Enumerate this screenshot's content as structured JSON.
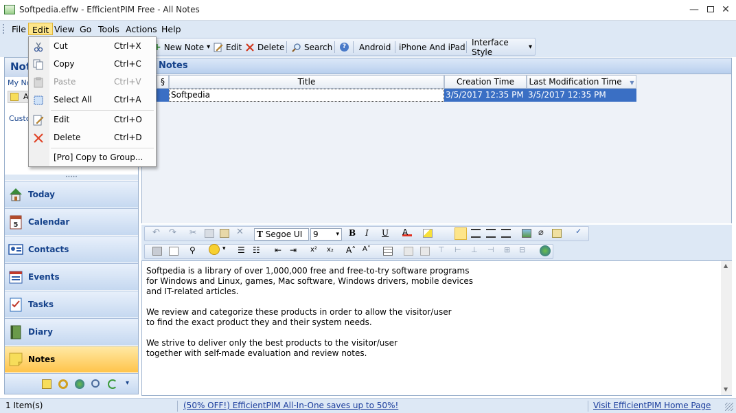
{
  "window": {
    "title": "Softpedia.effw - EfficientPIM Free - All Notes",
    "minimize": "—",
    "close": "✕"
  },
  "menubar": {
    "items": [
      "File",
      "Edit",
      "View",
      "Go",
      "Tools",
      "Actions",
      "Help"
    ]
  },
  "toolbar": {
    "new_note": "New Note",
    "edit": "Edit",
    "delete": "Delete",
    "search": "Search",
    "android": "Android",
    "iphone": "iPhone And iPad",
    "interface_style": "Interface Style",
    "dropdown_arrow": "▾"
  },
  "edit_menu": {
    "items": [
      {
        "label": "Cut",
        "shortcut": "Ctrl+X",
        "icon": "scissors-icon",
        "enabled": true
      },
      {
        "label": "Copy",
        "shortcut": "Ctrl+C",
        "icon": "copy-icon",
        "enabled": true
      },
      {
        "label": "Paste",
        "shortcut": "Ctrl+V",
        "icon": "paste-icon",
        "enabled": false
      },
      {
        "label": "Select All",
        "shortcut": "Ctrl+A",
        "icon": "select-all-icon",
        "enabled": true
      },
      {
        "label": "Edit",
        "shortcut": "Ctrl+O",
        "icon": "edit-pencil-icon",
        "enabled": true
      },
      {
        "label": "Delete",
        "shortcut": "Ctrl+D",
        "icon": "delete-x-icon",
        "enabled": true
      },
      {
        "label": "[Pro] Copy to Group...",
        "shortcut": "",
        "icon": "",
        "enabled": true
      }
    ]
  },
  "left_pane": {
    "header": "Not",
    "tree_item": "My No",
    "tree_sub": "A",
    "custom_label": "Custo",
    "splitter": "•••••",
    "nav": [
      {
        "label": "Today",
        "icon": "house-icon",
        "color": "#3a8a3a"
      },
      {
        "label": "Calendar",
        "icon": "calendar-icon",
        "color": "#b04a2a"
      },
      {
        "label": "Contacts",
        "icon": "contacts-card-icon",
        "color": "#2a5aa8"
      },
      {
        "label": "Events",
        "icon": "events-icon",
        "color": "#c0392b"
      },
      {
        "label": "Tasks",
        "icon": "tasks-checklist-icon",
        "color": "#2a6ab8"
      },
      {
        "label": "Diary",
        "icon": "diary-book-icon",
        "color": "#4a7a3a"
      },
      {
        "label": "Notes",
        "icon": "sticky-note-icon",
        "color": "#f5d34a"
      }
    ]
  },
  "main": {
    "header": "Notes",
    "columns": {
      "attach_glyph": "§",
      "title": "Title",
      "created": "Creation Time",
      "modified": "Last Modification Time",
      "sort_glyph": "▼"
    },
    "rows": [
      {
        "title": "Softpedia",
        "created": "3/5/2017 12:35 PM",
        "modified": "3/5/2017 12:35 PM"
      }
    ]
  },
  "editor_toolbar": {
    "font_prefix": "T",
    "font_name": "Segoe UI",
    "font_size": "9",
    "dropdown_arrow": "▾",
    "format": {
      "bold": "B",
      "italic": "I",
      "underline": "U",
      "font_color": "A",
      "superscript": "x²",
      "subscript": "x₂",
      "grow_font": "A˄",
      "shrink_font": "A˅"
    }
  },
  "editor": {
    "text": "Softpedia is a library of over 1,000,000 free and free-to-try software programs\nfor Windows and Linux, games, Mac software, Windows drivers, mobile devices\nand IT-related articles.\n\nWe review and categorize these products in order to allow the visitor/user\nto find the exact product they and their system needs.\n\nWe strive to deliver only the best products to the visitor/user\ntogether with self-made evaluation and review notes."
  },
  "statusbar": {
    "count": "1 Item(s)",
    "promo": "(50% OFF!) EfficientPIM All-In-One saves up to 50%!",
    "home": "Visit EfficientPIM Home Page"
  },
  "colors": {
    "accent": "#15428b",
    "selection": "#3a6fc4",
    "active_nav": "#ffc44a"
  }
}
